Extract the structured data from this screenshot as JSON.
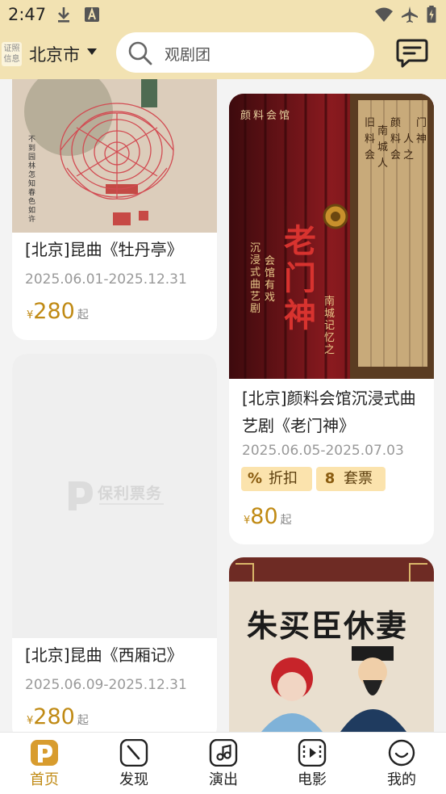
{
  "status_bar": {
    "time": "2:47"
  },
  "header": {
    "cert_badge": [
      "证照",
      "信息"
    ],
    "city": "北京市",
    "search_placeholder": "观剧团"
  },
  "cards": [
    {
      "title": "[北京]昆曲《牡丹亭》",
      "date": "2025.06.01-2025.12.31",
      "price_symbol": "¥",
      "price": "280",
      "price_suffix": "起",
      "poster_text": [
        "不到园林怎知春色如许"
      ]
    },
    {
      "title_lines": [
        "[北京]颜料会馆沉浸式曲",
        "艺剧《老门神》"
      ],
      "date": "2025.06.05-2025.07.03",
      "tags": [
        {
          "icon": "%",
          "label": "折扣"
        },
        {
          "icon": "8",
          "label": "套票"
        }
      ],
      "price_symbol": "¥",
      "price": "80",
      "price_suffix": "起",
      "poster_text": {
        "brand": "颜料会馆",
        "big_title": "老门神",
        "tagline": [
          "沉浸式曲艺剧",
          "会馆有戏",
          "南城记忆之"
        ]
      }
    },
    {
      "title": "[北京]昆曲《西厢记》",
      "date": "2025.06.09-2025.12.31",
      "price_symbol": "¥",
      "price": "280",
      "price_suffix": "起",
      "placeholder_logo": {
        "main": "保利票务"
      }
    },
    {
      "poster_text": {
        "title": "朱买臣休妻"
      }
    }
  ],
  "bottom_nav": [
    {
      "label": "首页",
      "icon": "home-logo-icon",
      "active": true
    },
    {
      "label": "发现",
      "icon": "compass-icon",
      "active": false
    },
    {
      "label": "演出",
      "icon": "music-note-icon",
      "active": false
    },
    {
      "label": "电影",
      "icon": "film-icon",
      "active": false
    },
    {
      "label": "我的",
      "icon": "smile-icon",
      "active": false
    }
  ],
  "colors": {
    "accent": "#c08a14",
    "header_bg": "#f2e2b2",
    "tag_bg": "#fbe3ad"
  }
}
